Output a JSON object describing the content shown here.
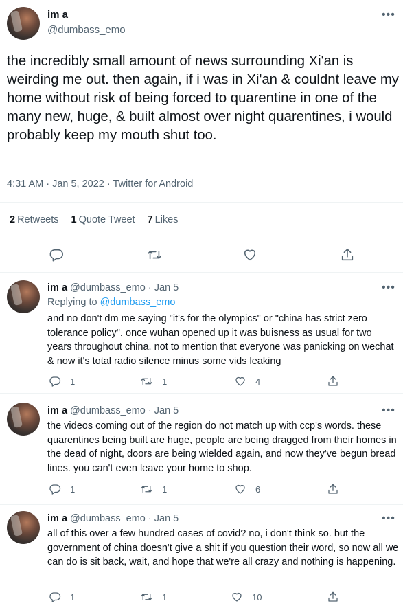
{
  "main_tweet": {
    "display_name": "im a",
    "handle": "@dumbass_emo",
    "text": "the incredibly small amount of news surrounding Xi'an is weirding me out. then again, if i was in Xi'an & couldnt leave my home without risk of being forced to quarentine in one of the many new, huge, & built almost over night quarentines, i would probably keep my mouth shut too.",
    "meta": "4:31 AM · Jan 5, 2022 · Twitter for Android",
    "stats": {
      "retweets_count": "2",
      "retweets_label": "Retweets",
      "quotes_count": "1",
      "quotes_label": "Quote Tweet",
      "likes_count": "7",
      "likes_label": "Likes"
    }
  },
  "replies": [
    {
      "display_name": "im a",
      "handle_date": "@dumbass_emo · Jan 5",
      "replying_prefix": "Replying to",
      "replying_handle": "@dumbass_emo",
      "text": "and no don't dm me saying \"it's for the olympics\" or \"china has strict zero tolerance policy\". once wuhan opened up it was buisness as usual for two years throughout china. not to mention that everyone was panicking on wechat & now it's total radio silence minus some vids leaking",
      "reply_count": "1",
      "retweet_count": "1",
      "like_count": "4"
    },
    {
      "display_name": "im a",
      "handle_date": "@dumbass_emo · Jan 5",
      "text": "the videos coming out of the region do not match up with ccp's words. these quarentines being built are huge, people are being dragged from their homes in the dead of night, doors are being wielded again, and now they've begun bread lines. you can't even leave your home to shop.",
      "reply_count": "1",
      "retweet_count": "1",
      "like_count": "6"
    },
    {
      "display_name": "im a",
      "handle_date": "@dumbass_emo · Jan 5",
      "text": "all of this over a few hundred cases of covid? no, i don't think so. but the government of china doesn't give a shit if you question their word, so now all we can do is sit back, wait, and hope that we're all crazy and nothing is happening.",
      "reply_count": "1",
      "retweet_count": "1",
      "like_count": "10"
    }
  ],
  "icons": {
    "more": "more-horizontal-icon",
    "reply": "reply-icon",
    "retweet": "retweet-icon",
    "like": "heart-icon",
    "share": "share-icon"
  },
  "colors": {
    "text": "#0f1419",
    "secondary": "#536471",
    "link": "#1d9bf0",
    "divider": "#eff3f4"
  }
}
